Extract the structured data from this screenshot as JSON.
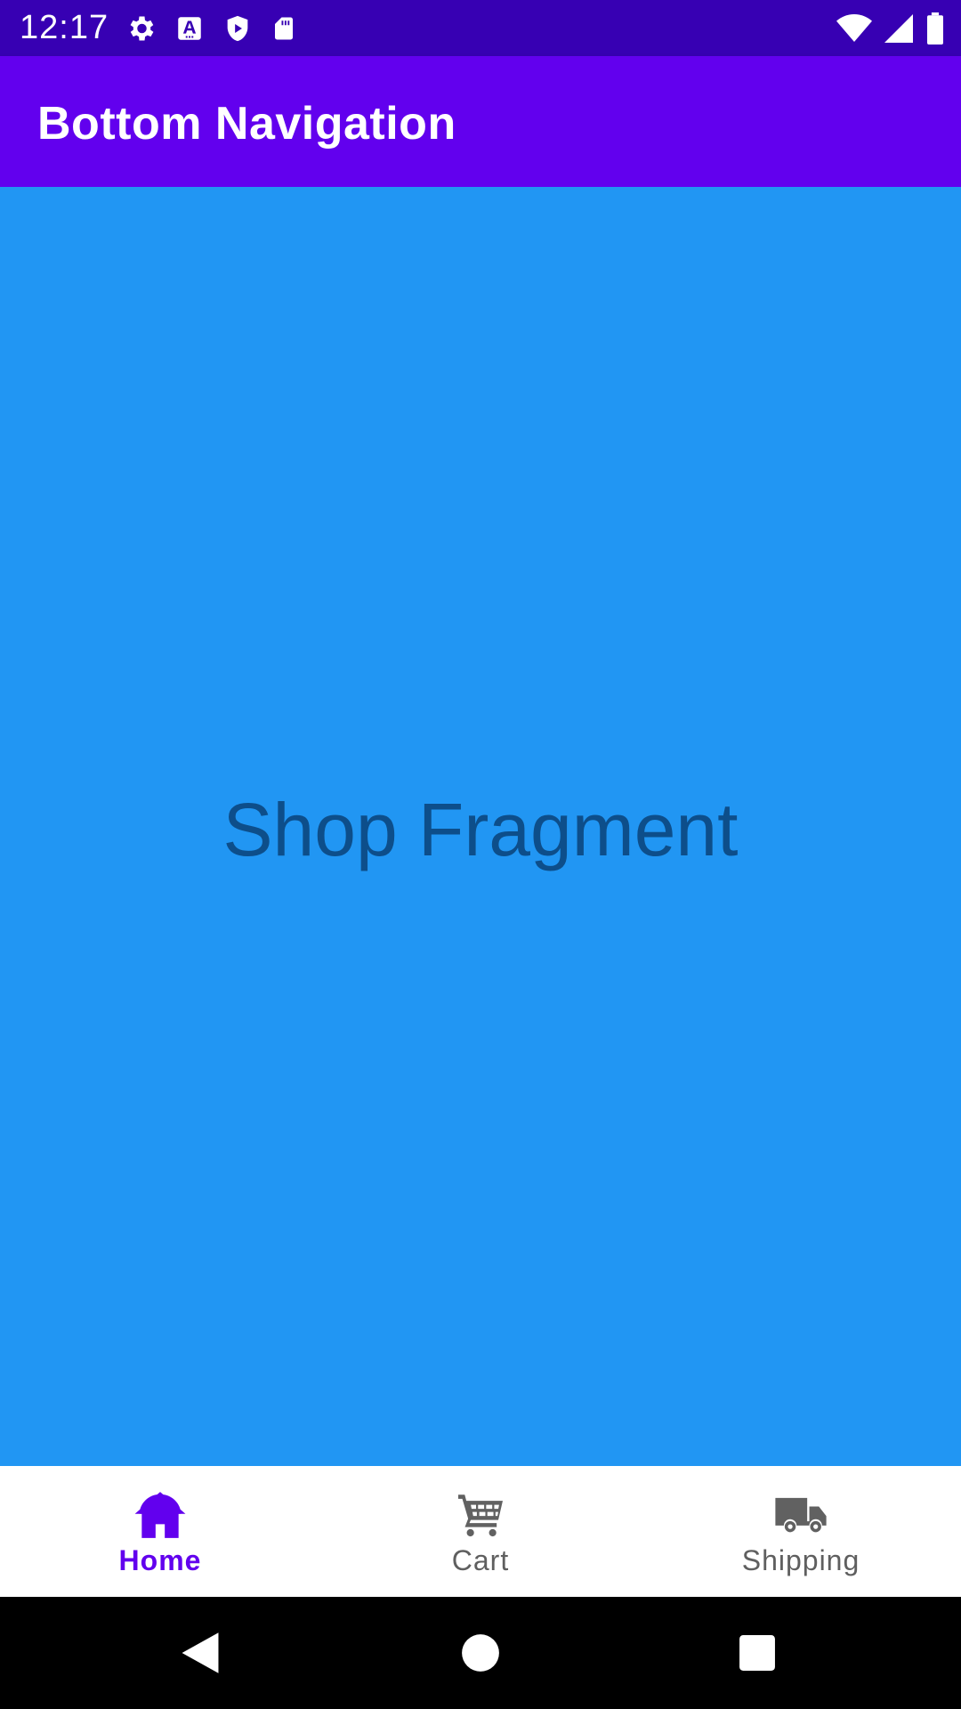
{
  "status_bar": {
    "time": "12:17",
    "icons_left": [
      "gear-icon",
      "font-a-icon",
      "shield-play-icon",
      "sd-card-icon"
    ],
    "icons_right": [
      "wifi-icon",
      "signal-icon",
      "battery-icon"
    ]
  },
  "app_bar": {
    "title": "Bottom Navigation"
  },
  "content": {
    "label": "Shop Fragment"
  },
  "bottom_nav": {
    "items": [
      {
        "label": "Home",
        "icon": "home-icon",
        "active": true
      },
      {
        "label": "Cart",
        "icon": "cart-icon",
        "active": false
      },
      {
        "label": "Shipping",
        "icon": "truck-icon",
        "active": false
      }
    ]
  },
  "system_nav": {
    "buttons": [
      "back-icon",
      "home-circle-icon",
      "recents-icon"
    ]
  },
  "colors": {
    "status_bar": "#3700B3",
    "app_bar": "#6200EE",
    "content_bg": "#2196F3",
    "content_text": "#0D4E8A",
    "nav_active": "#6200EE",
    "nav_inactive": "#5f5f5f"
  }
}
